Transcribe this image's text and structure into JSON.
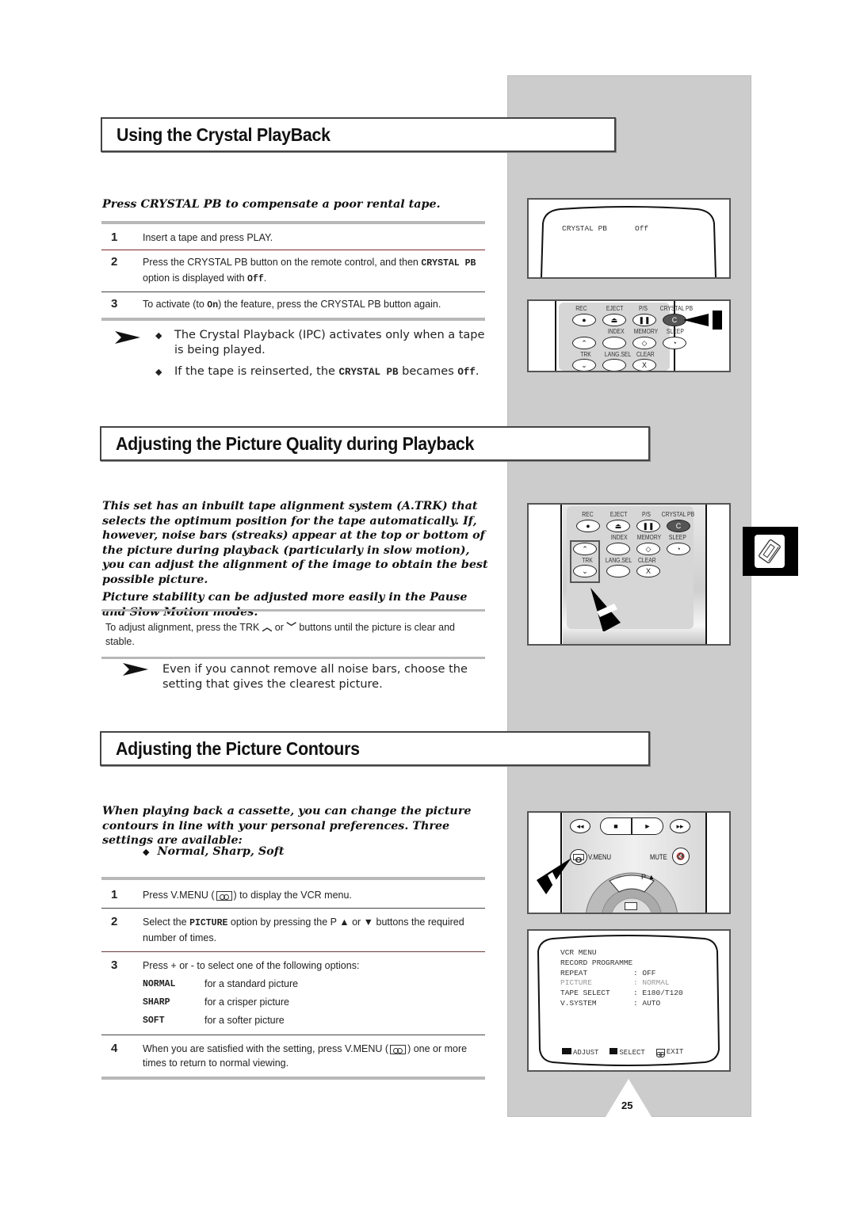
{
  "section1": {
    "title": "Using the Crystal PlayBack",
    "intro": "Press CRYSTAL PB to compensate a poor rental tape.",
    "steps": [
      {
        "num": "1",
        "text": "Insert a tape and press PLAY."
      },
      {
        "num": "2",
        "text_a": "Press the CRYSTAL PB button on the remote control, and then ",
        "mono_a": "CRYSTAL PB",
        "text_b": " option is displayed with ",
        "mono_b": "Off",
        "text_c": "."
      },
      {
        "num": "3",
        "text_a": "To activate (to ",
        "mono_a": "On",
        "text_b": ") the feature, press the CRYSTAL PB button again."
      }
    ],
    "notes": [
      {
        "text": "The Crystal Playback (IPC) activates only when a tape is being played."
      },
      {
        "text_a": "If the tape is reinserted, the ",
        "mono_a": "CRYSTAL PB",
        "text_b": " becames ",
        "mono_b": "Off",
        "text_c": "."
      }
    ],
    "screen": {
      "label": "CRYSTAL PB",
      "value": "Off"
    }
  },
  "remote_buttons": {
    "rec": "REC",
    "eject": "EJECT",
    "ps": "P/S",
    "crystal_pb": "CRYSTAL PB",
    "index": "INDEX",
    "memory": "MEMORY",
    "sleep": "SLEEP",
    "trk": "TRK",
    "lang_sel": "LANG.SEL",
    "clear": "CLEAR",
    "clear_glyph": "X"
  },
  "section2": {
    "title": "Adjusting the Picture Quality during Playback",
    "intro1": "This set has an inbuilt tape alignment system (A.TRK) that selects the optimum position for the tape automatically. If, however, noise bars (streaks) appear at the top or bottom of the picture during playback (particularly in slow motion), you can adjust the alignment of the image to obtain the best possible picture.",
    "intro2": "Picture stability can be adjusted more easily in the Pause and Slow Motion modes.",
    "instruction_a": "To adjust alignment, press the TRK ",
    "instruction_or": " or ",
    "instruction_b": " buttons until the picture is clear and stable.",
    "note": "Even if you cannot remove all noise bars, choose the setting that gives the clearest picture."
  },
  "section3": {
    "title": "Adjusting the Picture Contours",
    "intro": "When playing back a cassette, you can change the picture contours in line with your personal preferences. Three settings are available:",
    "bullet": "Normal, Sharp, Soft",
    "steps": [
      {
        "num": "1",
        "text_a": "Press V.MENU (",
        "text_b": ") to display the VCR menu."
      },
      {
        "num": "2",
        "text_a": "Select the ",
        "mono_a": "PICTURE",
        "text_b": " option by pressing the P ▲ or ▼ buttons the required number of times."
      },
      {
        "num": "3",
        "text": "Press + or - to select one of the following options:"
      },
      {
        "num": "4",
        "text_a": "When you are satisfied with the setting, press V.MENU (",
        "text_b": ") one or more times to return to normal viewing."
      }
    ],
    "options": [
      {
        "key": "NORMAL",
        "desc": "for a standard picture"
      },
      {
        "key": "SHARP",
        "desc": "for a crisper picture"
      },
      {
        "key": "SOFT",
        "desc": "for a softer picture"
      }
    ],
    "remote": {
      "vmenu": "V.MENU",
      "mute": "MUTE",
      "p_up": "P ▲"
    },
    "vcr_menu": {
      "title": "VCR MENU",
      "record": "RECORD PROGRAMME",
      "rows": [
        {
          "label": "REPEAT",
          "value": ": OFF",
          "highlight": false
        },
        {
          "label": "PICTURE",
          "value": ": NORMAL",
          "highlight": true
        },
        {
          "label": "TAPE SELECT",
          "value": ": E180/T120",
          "highlight": false
        },
        {
          "label": "V.SYSTEM",
          "value": ": AUTO",
          "highlight": false
        }
      ],
      "footer": {
        "adjust": "ADJUST",
        "select": "SELECT",
        "exit": "EXIT"
      }
    }
  },
  "page_number": "25"
}
